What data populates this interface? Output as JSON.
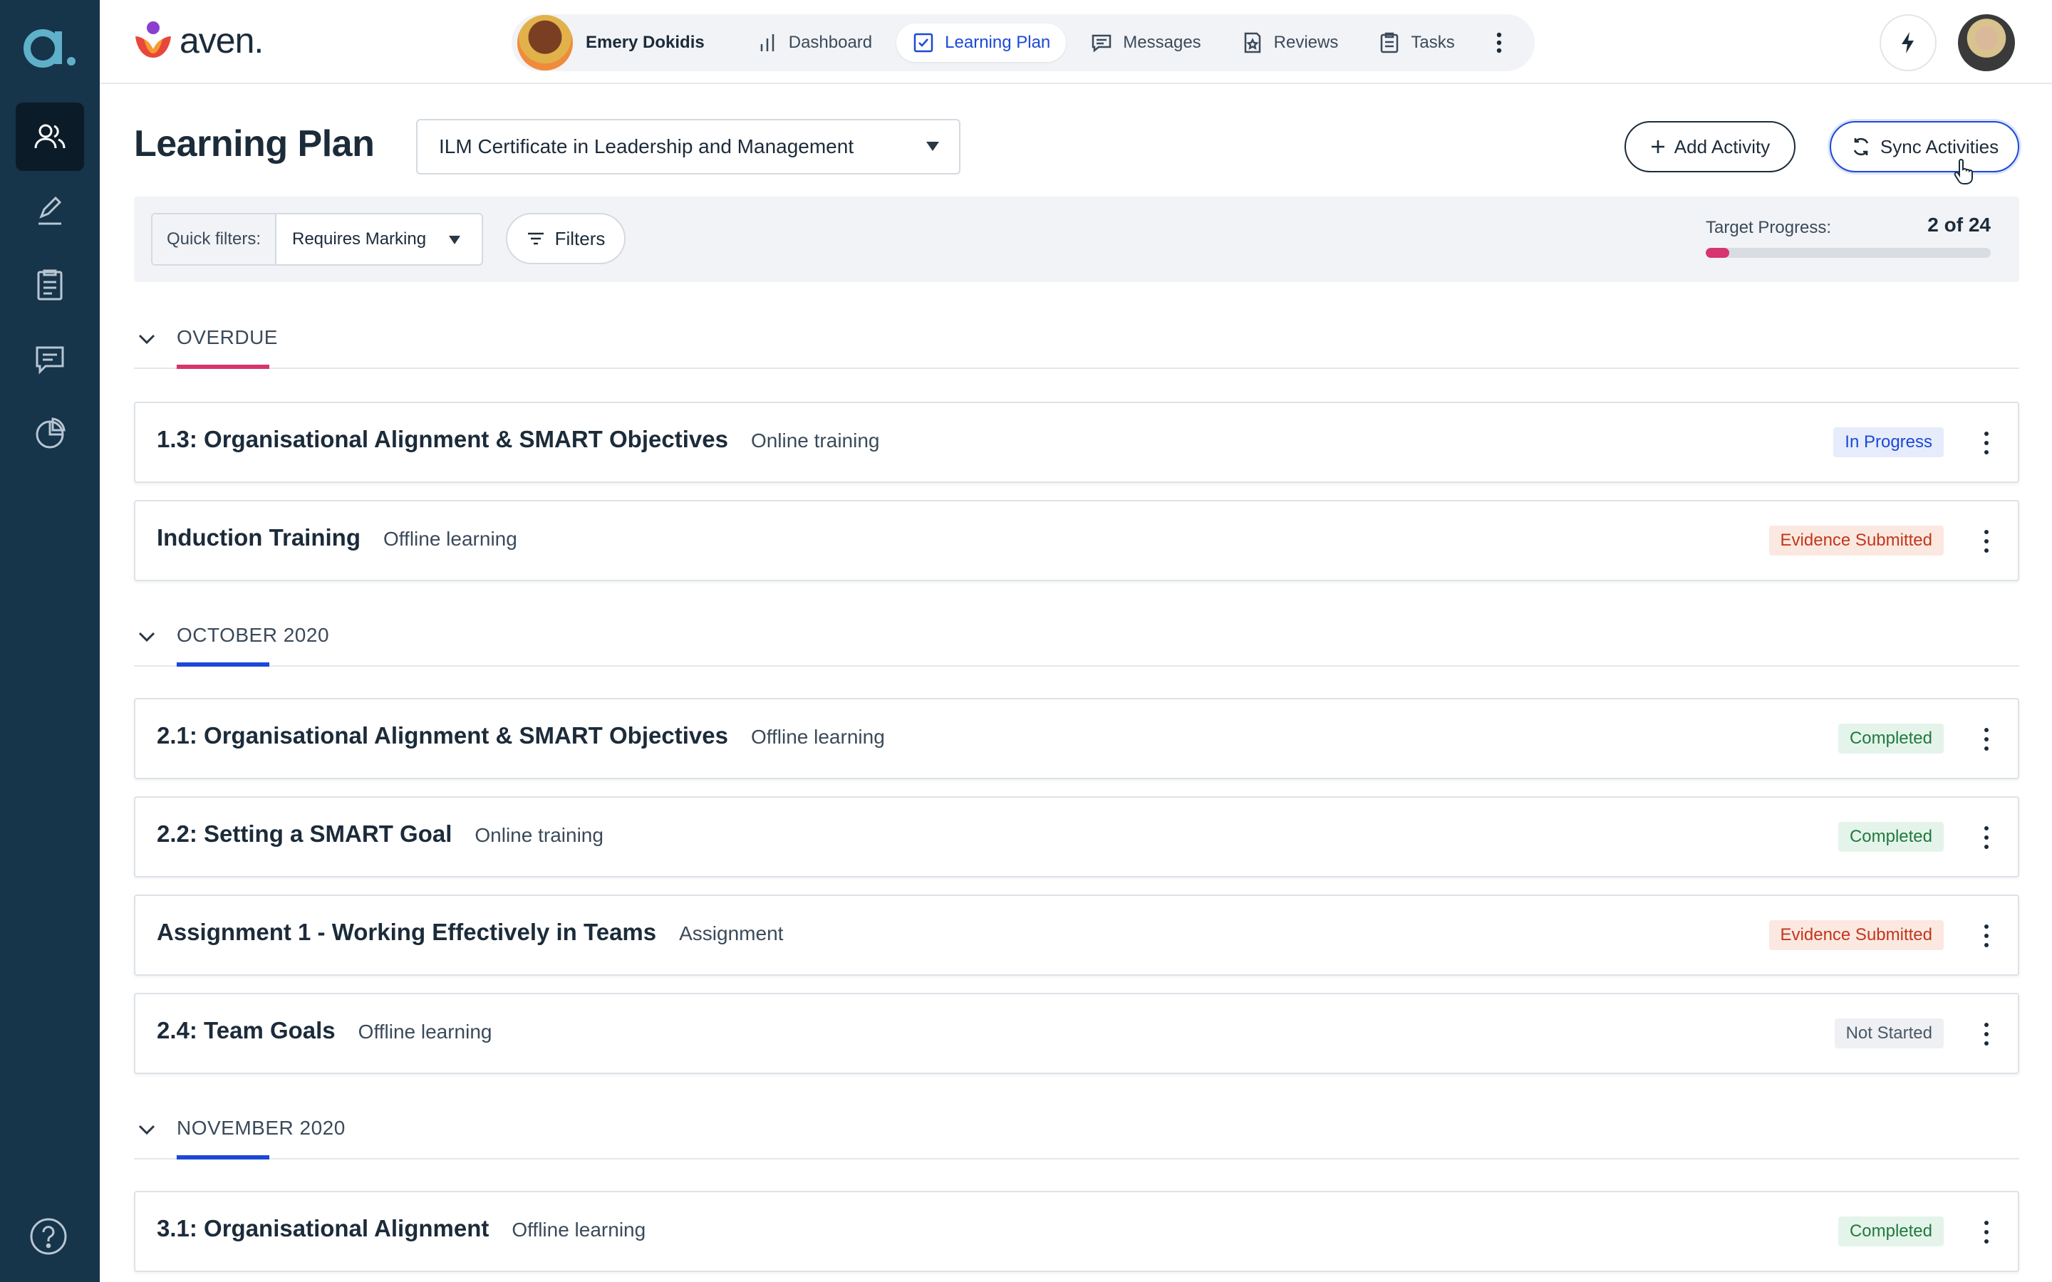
{
  "app": {
    "brand": "aven."
  },
  "nav": {
    "user_name": "Emery Dokidis",
    "items": [
      {
        "label": "Dashboard"
      },
      {
        "label": "Learning Plan"
      },
      {
        "label": "Messages"
      },
      {
        "label": "Reviews"
      },
      {
        "label": "Tasks"
      }
    ]
  },
  "page": {
    "title": "Learning Plan",
    "plan_select": "ILM Certificate in Leadership and Management",
    "add_activity": "Add Activity",
    "sync_activities": "Sync Activities"
  },
  "filters": {
    "quick_label": "Quick filters:",
    "quick_value": "Requires Marking",
    "filters_button": "Filters",
    "target_label": "Target Progress:",
    "target_value": "2 of 24",
    "target_fraction": 0.083
  },
  "colors": {
    "accent": "#1b49d6",
    "overdue": "#d7356d",
    "rail": "#16344a"
  },
  "sections": [
    {
      "title": "OVERDUE",
      "rows": [
        {
          "title": "1.3: Organisational Alignment & SMART Objectives",
          "type": "Online training",
          "status": "In Progress"
        },
        {
          "title": "Induction Training",
          "type": "Offline learning",
          "status": "Evidence Submitted"
        }
      ]
    },
    {
      "title": "OCTOBER 2020",
      "rows": [
        {
          "title": "2.1: Organisational Alignment & SMART Objectives",
          "type": "Offline learning",
          "status": "Completed"
        },
        {
          "title": "2.2: Setting a SMART Goal",
          "type": "Online training",
          "status": "Completed"
        },
        {
          "title": "Assignment 1 - Working Effectively in Teams",
          "type": "Assignment",
          "status": "Evidence Submitted"
        },
        {
          "title": "2.4: Team Goals",
          "type": "Offline learning",
          "status": "Not Started"
        }
      ]
    },
    {
      "title": "NOVEMBER 2020",
      "rows": [
        {
          "title": "3.1: Organisational Alignment",
          "type": "Offline learning",
          "status": "Completed"
        }
      ]
    }
  ]
}
